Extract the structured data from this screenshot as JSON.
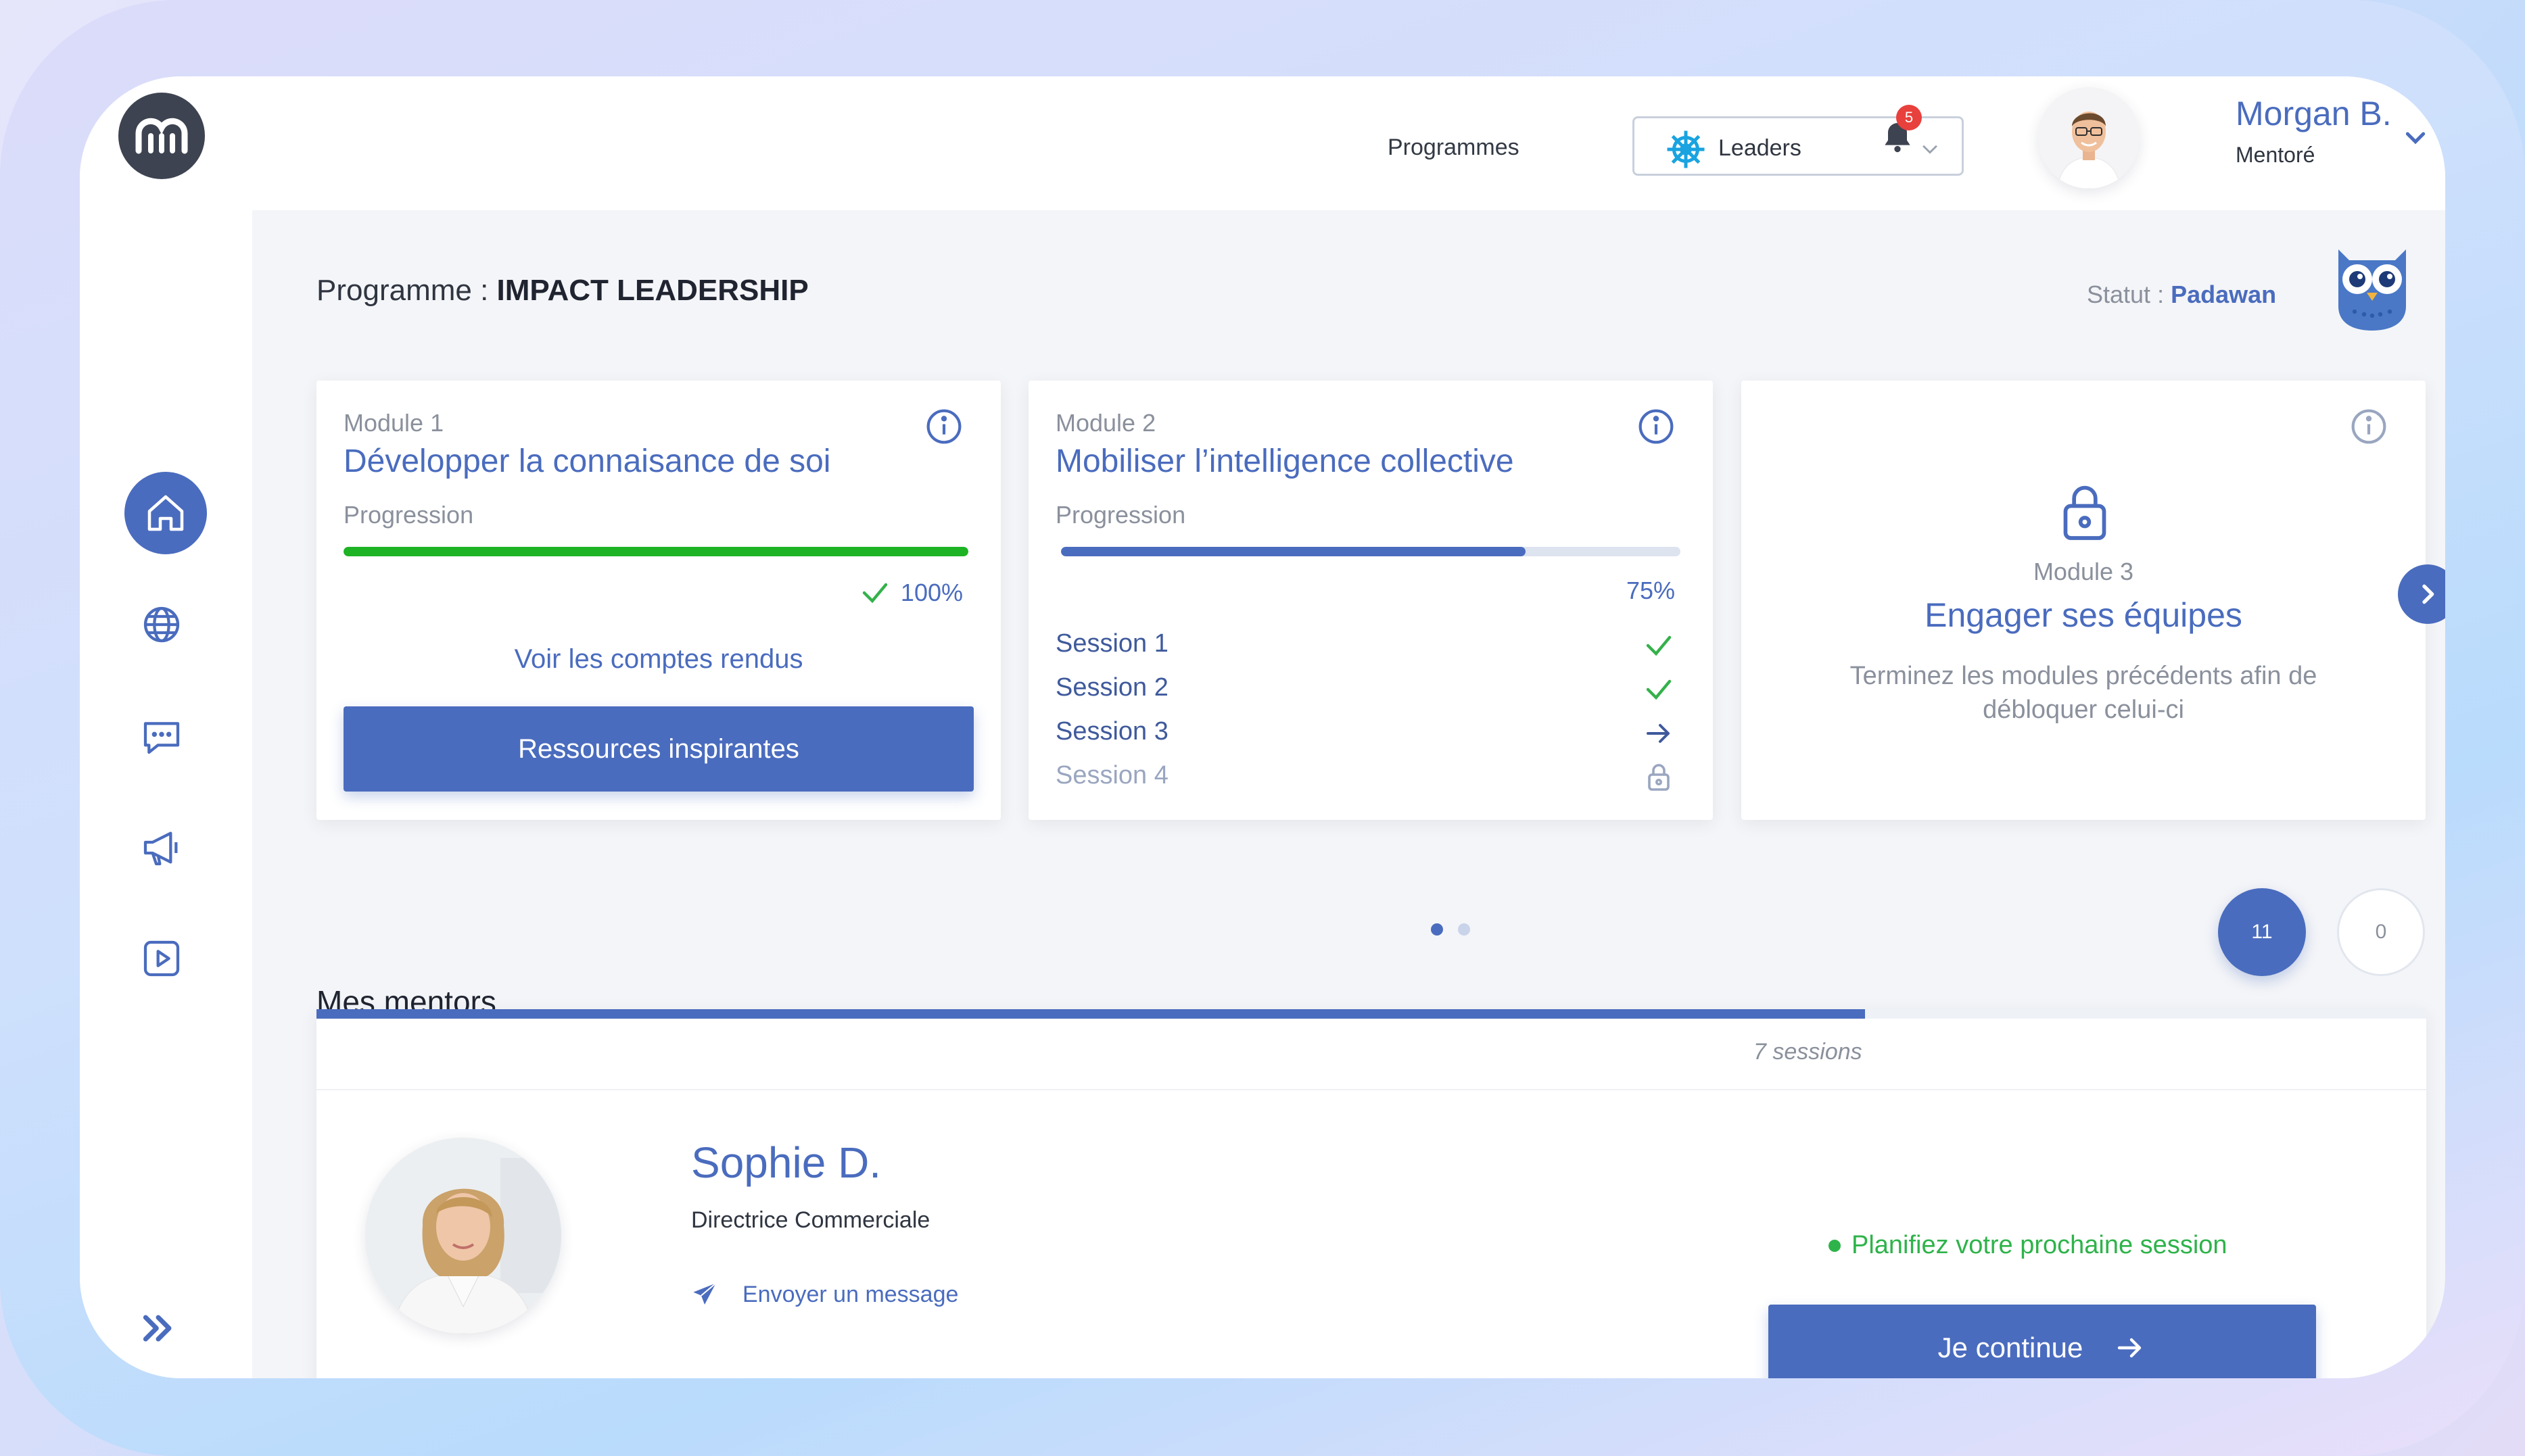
{
  "header": {
    "programmes_label": "Programmes",
    "programme_select": "Leaders",
    "notifications_count": "5",
    "user_name": "Morgan B.",
    "user_role": "Mentoré"
  },
  "page": {
    "title_prefix": "Programme : ",
    "title": "IMPACT LEADERSHIP",
    "status_label": "Statut : ",
    "status_value": "Padawan"
  },
  "modules": [
    {
      "num": "Module 1",
      "title": "Développer la connaisance de soi",
      "progress_label": "Progression",
      "progress": 100,
      "progress_text": "100%",
      "link": "Voir les comptes rendus",
      "button": "Ressources inspirantes"
    },
    {
      "num": "Module 2",
      "title": "Mobiliser l’intelligence collective",
      "progress_label": "Progression",
      "progress": 75,
      "progress_text": "75%",
      "sessions": [
        "Session 1",
        "Session 2",
        "Session 3",
        "Session 4"
      ]
    },
    {
      "num": "Module 3",
      "title": "Engager ses équipes",
      "hint": "Terminez les modules précédents afin de débloquer celui-ci"
    }
  ],
  "mentors": {
    "title": "Mes mentors",
    "count_active": "11",
    "count_other": "0",
    "sessions_text": "7 sessions",
    "progress_fraction": 0.734,
    "mentor": {
      "name": "Sophie D.",
      "role": "Directrice Commerciale",
      "message_link": "Envoyer un message",
      "plan_text": "Planifiez votre prochaine session",
      "cta": "Je continue"
    }
  },
  "colors": {
    "accent": "#4a6cbe",
    "success": "#2eb34a",
    "badge": "#e8403c"
  }
}
